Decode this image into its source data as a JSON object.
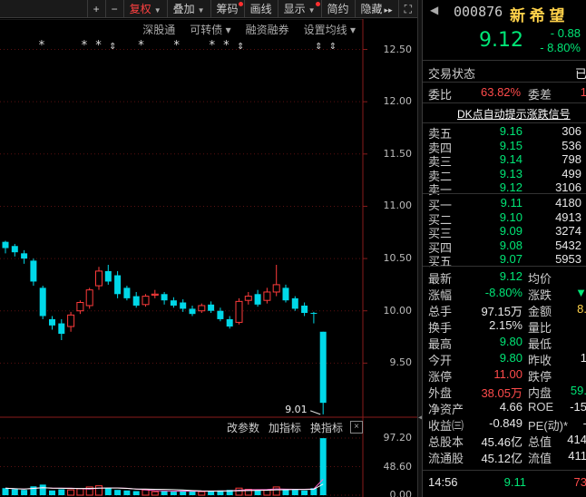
{
  "toolbar": {
    "plus": "+",
    "minus": "−",
    "items": [
      {
        "label": "复权",
        "color": "red",
        "caret": true
      },
      {
        "label": "叠加",
        "caret": true
      },
      {
        "label": "筹码",
        "dot": true
      },
      {
        "label": "画线"
      },
      {
        "label": "显示",
        "caret": true,
        "dot": true
      },
      {
        "label": "简约"
      },
      {
        "label": "隐藏",
        "suffix": "▸▸"
      },
      {
        "label": "⛶"
      }
    ]
  },
  "subheader": [
    "深股通",
    "可转债 ▾",
    "融资融券",
    "设置均线 ▾"
  ],
  "markers": "*     * * ⇕   *    *    * * ⇕          ⇕ ⇕",
  "y_axis_ticks": [
    "12.50",
    "12.00",
    "11.50",
    "11.00",
    "10.50",
    "10.00",
    "9.50"
  ],
  "low_label": "9.01",
  "indicator_header": {
    "items": [
      "改参数",
      "加指标",
      "换指标"
    ],
    "close": "×"
  },
  "indicator_ticks": [
    "97.20",
    "48.60",
    "0.00"
  ],
  "chart_data": {
    "type": "candlestick",
    "ylim": [
      9.0,
      12.6
    ],
    "candles": [
      {
        "o": 10.66,
        "c": 10.6,
        "h": 10.67,
        "l": 10.55
      },
      {
        "o": 10.62,
        "c": 10.56,
        "h": 10.64,
        "l": 10.52
      },
      {
        "o": 10.55,
        "c": 10.5,
        "h": 10.58,
        "l": 10.45
      },
      {
        "o": 10.48,
        "c": 10.28,
        "h": 10.5,
        "l": 10.24
      },
      {
        "o": 10.22,
        "c": 9.95,
        "h": 10.24,
        "l": 9.92
      },
      {
        "o": 9.92,
        "c": 9.86,
        "h": 9.95,
        "l": 9.82
      },
      {
        "o": 9.88,
        "c": 9.78,
        "h": 9.92,
        "l": 9.72
      },
      {
        "o": 9.85,
        "c": 9.96,
        "h": 9.99,
        "l": 9.8
      },
      {
        "o": 10.0,
        "c": 10.08,
        "h": 10.1,
        "l": 9.97
      },
      {
        "o": 10.05,
        "c": 10.2,
        "h": 10.22,
        "l": 10.02
      },
      {
        "o": 10.24,
        "c": 10.38,
        "h": 10.42,
        "l": 10.2
      },
      {
        "o": 10.38,
        "c": 10.28,
        "h": 10.44,
        "l": 10.25
      },
      {
        "o": 10.34,
        "c": 10.16,
        "h": 10.38,
        "l": 10.12
      },
      {
        "o": 10.22,
        "c": 10.12,
        "h": 10.24,
        "l": 10.1
      },
      {
        "o": 10.14,
        "c": 10.05,
        "h": 10.18,
        "l": 10.03
      },
      {
        "o": 10.06,
        "c": 10.14,
        "h": 10.16,
        "l": 10.04
      },
      {
        "o": 10.15,
        "c": 10.16,
        "h": 10.2,
        "l": 10.12
      },
      {
        "o": 10.16,
        "c": 10.1,
        "h": 10.18,
        "l": 10.06
      },
      {
        "o": 10.1,
        "c": 10.05,
        "h": 10.13,
        "l": 10.03
      },
      {
        "o": 10.08,
        "c": 10.02,
        "h": 10.11,
        "l": 9.99
      },
      {
        "o": 10.02,
        "c": 9.97,
        "h": 10.05,
        "l": 9.95
      },
      {
        "o": 10.0,
        "c": 10.05,
        "h": 10.07,
        "l": 9.98
      },
      {
        "o": 10.06,
        "c": 10.0,
        "h": 10.09,
        "l": 9.98
      },
      {
        "o": 10.0,
        "c": 9.92,
        "h": 10.03,
        "l": 9.9
      },
      {
        "o": 9.92,
        "c": 9.85,
        "h": 9.95,
        "l": 9.83
      },
      {
        "o": 9.89,
        "c": 10.09,
        "h": 10.12,
        "l": 9.87
      },
      {
        "o": 10.1,
        "c": 10.14,
        "h": 10.18,
        "l": 10.06
      },
      {
        "o": 10.16,
        "c": 10.06,
        "h": 10.2,
        "l": 10.04
      },
      {
        "o": 10.1,
        "c": 10.18,
        "h": 10.22,
        "l": 10.07
      },
      {
        "o": 10.18,
        "c": 10.25,
        "h": 10.44,
        "l": 10.14
      },
      {
        "o": 10.22,
        "c": 10.1,
        "h": 10.25,
        "l": 10.08
      },
      {
        "o": 10.12,
        "c": 10.02,
        "h": 10.14,
        "l": 10.0
      },
      {
        "o": 10.05,
        "c": 9.98,
        "h": 10.08,
        "l": 9.95
      },
      {
        "o": 9.98,
        "c": 9.98,
        "h": 9.99,
        "l": 9.88
      },
      {
        "o": 9.8,
        "c": 9.12,
        "h": 9.8,
        "l": 9.01
      }
    ],
    "volumes": [
      12,
      10,
      9,
      15,
      18,
      8,
      10,
      9,
      11,
      14,
      16,
      12,
      9,
      8,
      7,
      9,
      6,
      7,
      6,
      8,
      7,
      6,
      7,
      8,
      9,
      12,
      10,
      8,
      9,
      14,
      10,
      9,
      8,
      12,
      97
    ],
    "vol_ylim": [
      0,
      97.2
    ],
    "up_color": "#ff3b3b",
    "down_color": "#00d8e8"
  },
  "quote": {
    "code": "000876",
    "name": "新 希 望",
    "price": "9.12",
    "change": "- 0.88",
    "change_pct": "- 8.80%"
  },
  "status": {
    "label": "交易状态",
    "value": "已"
  },
  "ratio": {
    "label": "委比",
    "value": "63.82%",
    "label2": "委差",
    "value2": "1"
  },
  "dk_label": "DK点自动提示涨跌信号",
  "sells": [
    {
      "label": "卖五",
      "price": "9.16",
      "vol": "306"
    },
    {
      "label": "卖四",
      "price": "9.15",
      "vol": "536"
    },
    {
      "label": "卖三",
      "price": "9.14",
      "vol": "798"
    },
    {
      "label": "卖二",
      "price": "9.13",
      "vol": "499"
    },
    {
      "label": "卖一",
      "price": "9.12",
      "vol": "3106"
    }
  ],
  "buys": [
    {
      "label": "买一",
      "price": "9.11",
      "vol": "4180"
    },
    {
      "label": "买二",
      "price": "9.10",
      "vol": "4913"
    },
    {
      "label": "买三",
      "price": "9.09",
      "vol": "3274"
    },
    {
      "label": "买四",
      "price": "9.08",
      "vol": "5432"
    },
    {
      "label": "买五",
      "price": "9.07",
      "vol": "5953"
    }
  ],
  "stats": [
    {
      "l1": "最新",
      "v1": "9.12",
      "c1": "green",
      "l2": "均价",
      "v2": ""
    },
    {
      "l1": "涨幅",
      "v1": "-8.80%",
      "c1": "green",
      "l2": "涨跌",
      "v2": "▼",
      "c2": "green"
    },
    {
      "l1": "总手",
      "v1": "97.15万",
      "c1": "white",
      "l2": "金额",
      "v2": "8.",
      "c2": "yellow"
    },
    {
      "l1": "换手",
      "v1": "2.15%",
      "c1": "white",
      "l2": "量比",
      "v2": ""
    },
    {
      "l1": "最高",
      "v1": "9.80",
      "c1": "green",
      "l2": "最低",
      "v2": ""
    },
    {
      "l1": "今开",
      "v1": "9.80",
      "c1": "green",
      "l2": "昨收",
      "v2": "1"
    },
    {
      "l1": "涨停",
      "v1": "11.00",
      "c1": "red",
      "l2": "跌停",
      "v2": ""
    },
    {
      "l1": "外盘",
      "v1": "38.05万",
      "c1": "red",
      "l2": "内盘",
      "v2": "59.",
      "c2": "green"
    },
    {
      "l1": "净资产",
      "v1": "4.66",
      "c1": "white",
      "l2": "ROE",
      "v2": "-15"
    },
    {
      "l1": "收益㈢",
      "v1": "-0.849",
      "c1": "white",
      "l2": "PE(动)*",
      "v2": "-"
    },
    {
      "l1": "总股本",
      "v1": "45.46亿",
      "c1": "white",
      "l2": "总值",
      "v2": "414"
    },
    {
      "l1": "流通股",
      "v1": "45.12亿",
      "c1": "white",
      "l2": "流值",
      "v2": "411"
    }
  ],
  "tick": {
    "time": "14:56",
    "price": "9.11",
    "vol": "73"
  }
}
